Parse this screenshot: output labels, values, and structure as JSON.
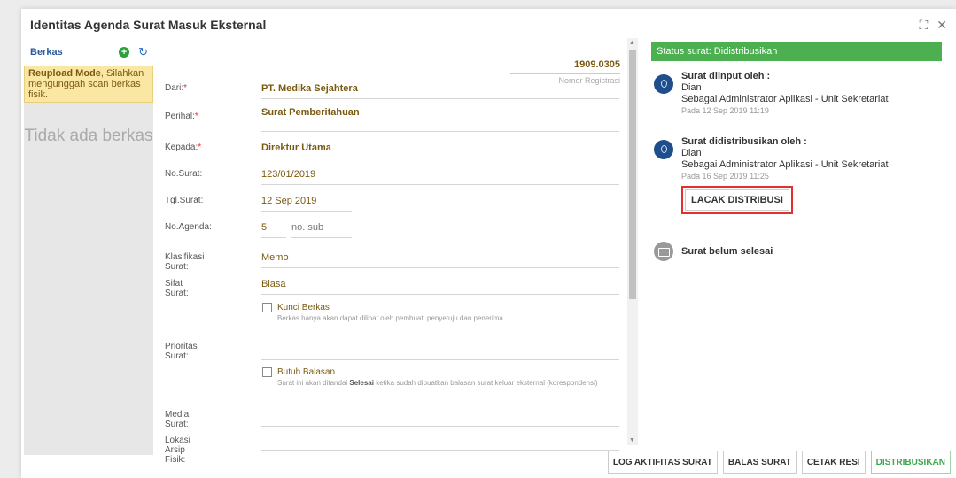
{
  "dialog": {
    "title": "Identitas Agenda Surat Masuk Eksternal",
    "expand_icon": "expand-icon",
    "close_icon": "close-icon"
  },
  "berkas": {
    "label": "Berkas",
    "add_icon": "plus-circle-icon",
    "refresh_icon": "refresh-icon",
    "notice_bold": "Reupload Mode",
    "notice_text": ", Silahkan mengunggah scan berkas fisik.",
    "no_file": "Tidak ada berkas"
  },
  "registration": {
    "number": "1909.0305",
    "caption": "Nomor Registrasi"
  },
  "form": {
    "dari": {
      "label": "Dari:",
      "required": "*",
      "value": "PT. Medika Sejahtera"
    },
    "perihal": {
      "label": "Perihal:",
      "required": "*",
      "value": "Surat Pemberitahuan"
    },
    "kepada": {
      "label": "Kepada:",
      "required": "*",
      "value": "Direktur Utama"
    },
    "no_surat": {
      "label": "No.Surat:",
      "value": "123/01/2019"
    },
    "tgl_surat": {
      "label": "Tgl.Surat:",
      "value": "12 Sep 2019"
    },
    "no_agenda": {
      "label": "No.Agenda:",
      "value": "5",
      "sub_placeholder": "no. sub"
    },
    "klasifikasi": {
      "label": "Klasifikasi Surat:",
      "value": "Memo"
    },
    "sifat": {
      "label": "Sifat Surat:",
      "value": "Biasa"
    },
    "kunci": {
      "title": "Kunci Berkas",
      "desc": "Berkas hanya akan dapat dilihat oleh pembuat, penyetuju dan penerima"
    },
    "prioritas": {
      "label": "Prioritas Surat:",
      "value": ""
    },
    "butuh": {
      "title": "Butuh Balasan",
      "desc_pre": "Surat ini akan ditandai ",
      "desc_bold": "Selesai",
      "desc_post": " ketika sudah dibuatkan balasan surat keluar eksternal (korespondensi)"
    },
    "media": {
      "label": "Media Surat:",
      "value": ""
    },
    "lokasi": {
      "label": "Lokasi Arsip Fisik:",
      "value": ""
    }
  },
  "status": {
    "bar": "Status surat: Didistribusikan",
    "entries": [
      {
        "title": "Surat diinput oleh :",
        "name": "Dian",
        "role": "Sebagai Administrator Aplikasi - Unit Sekretariat",
        "time": "Pada 12 Sep 2019 11:19"
      },
      {
        "title": "Surat didistribusikan oleh :",
        "name": "Dian",
        "role": "Sebagai Administrator Aplikasi - Unit Sekretariat",
        "time": "Pada 16 Sep 2019 11:25"
      }
    ],
    "track_button": "LACAK DISTRIBUSI",
    "not_done": "Surat belum selesai"
  },
  "footer": {
    "log": "LOG AKTIFITAS SURAT",
    "balas": "BALAS SURAT",
    "cetak": "CETAK RESI",
    "distribusi": "DISTRIBUSIKAN"
  },
  "colors": {
    "status_green": "#4caf50",
    "highlight_red": "#e03030",
    "value_brown": "#7a5a12"
  }
}
